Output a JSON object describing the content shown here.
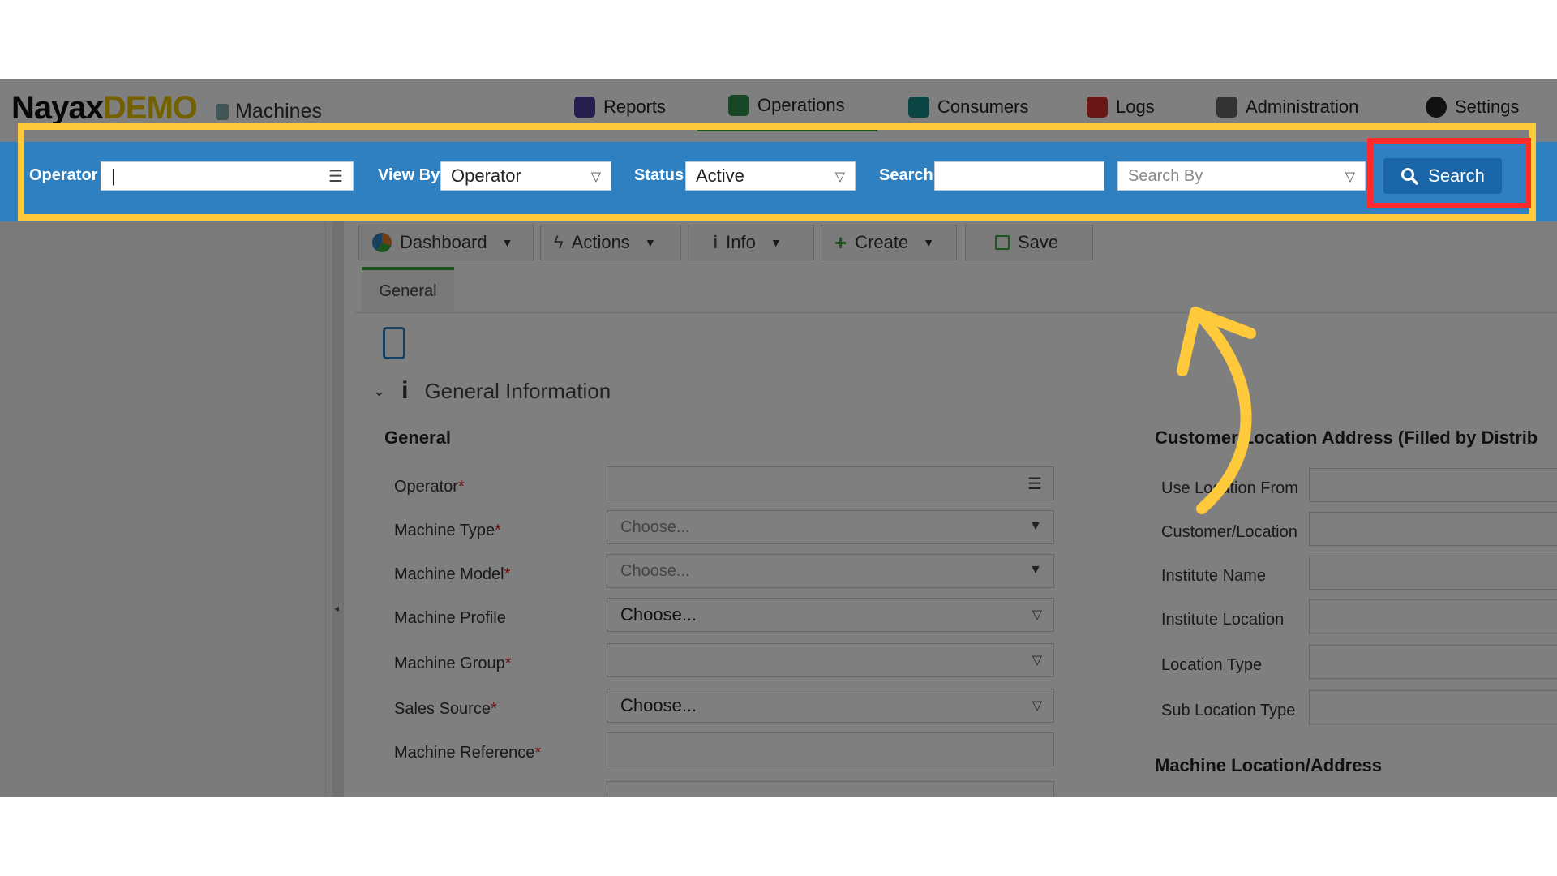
{
  "app": {
    "logo_main": "Nayax",
    "logo_accent": "DEMO",
    "section": "Machines"
  },
  "nav": [
    {
      "label": "Reports",
      "icon": "reports-icon",
      "color": "#4b3fa0"
    },
    {
      "label": "Operations",
      "icon": "operations-icon",
      "color": "#2f8f4a"
    },
    {
      "label": "Consumers",
      "icon": "consumers-icon",
      "color": "#1a8a8a"
    },
    {
      "label": "Logs",
      "icon": "logs-icon",
      "color": "#d32f2f"
    },
    {
      "label": "Administration",
      "icon": "administration-icon",
      "color": "#555555"
    },
    {
      "label": "Settings",
      "icon": "gear-icon",
      "color": "#222222"
    }
  ],
  "filter": {
    "operator_label": "Operator",
    "operator_value": "|",
    "viewby_label": "View By",
    "viewby_value": "Operator",
    "status_label": "Status",
    "status_value": "Active",
    "search_label": "Search",
    "search_value": "",
    "searchby_placeholder": "Search By",
    "search_button": "Search"
  },
  "toolbar": {
    "dashboard": "Dashboard",
    "actions": "Actions",
    "info": "Info",
    "create": "Create",
    "save": "Save"
  },
  "tabs": [
    "General"
  ],
  "section": {
    "title": "General Information",
    "left_heading": "General",
    "right_heading": "Customer/Location Address (Filled by Distrib",
    "bottom_heading": "Machine Location/Address"
  },
  "form": {
    "fields": [
      {
        "label": "Operator",
        "required": true,
        "value": ""
      },
      {
        "label": "Machine Type",
        "required": true,
        "value": "Choose..."
      },
      {
        "label": "Machine Model",
        "required": true,
        "value": "Choose..."
      },
      {
        "label": "Machine Profile",
        "required": false,
        "value": "Choose..."
      },
      {
        "label": "Machine Group",
        "required": true,
        "value": ""
      },
      {
        "label": "Sales Source",
        "required": true,
        "value": "Choose..."
      },
      {
        "label": "Machine Reference",
        "required": true,
        "value": ""
      }
    ],
    "right_fields": [
      "Use Location From",
      "Customer/Location",
      "Institute Name",
      "Institute Location",
      "Location Type",
      "Sub Location Type"
    ]
  },
  "colors": {
    "filterbar": "#2f80c1",
    "highlight_yellow": "#ffc93c",
    "highlight_red": "#ff2a2a",
    "search_button": "#1a64a8"
  }
}
